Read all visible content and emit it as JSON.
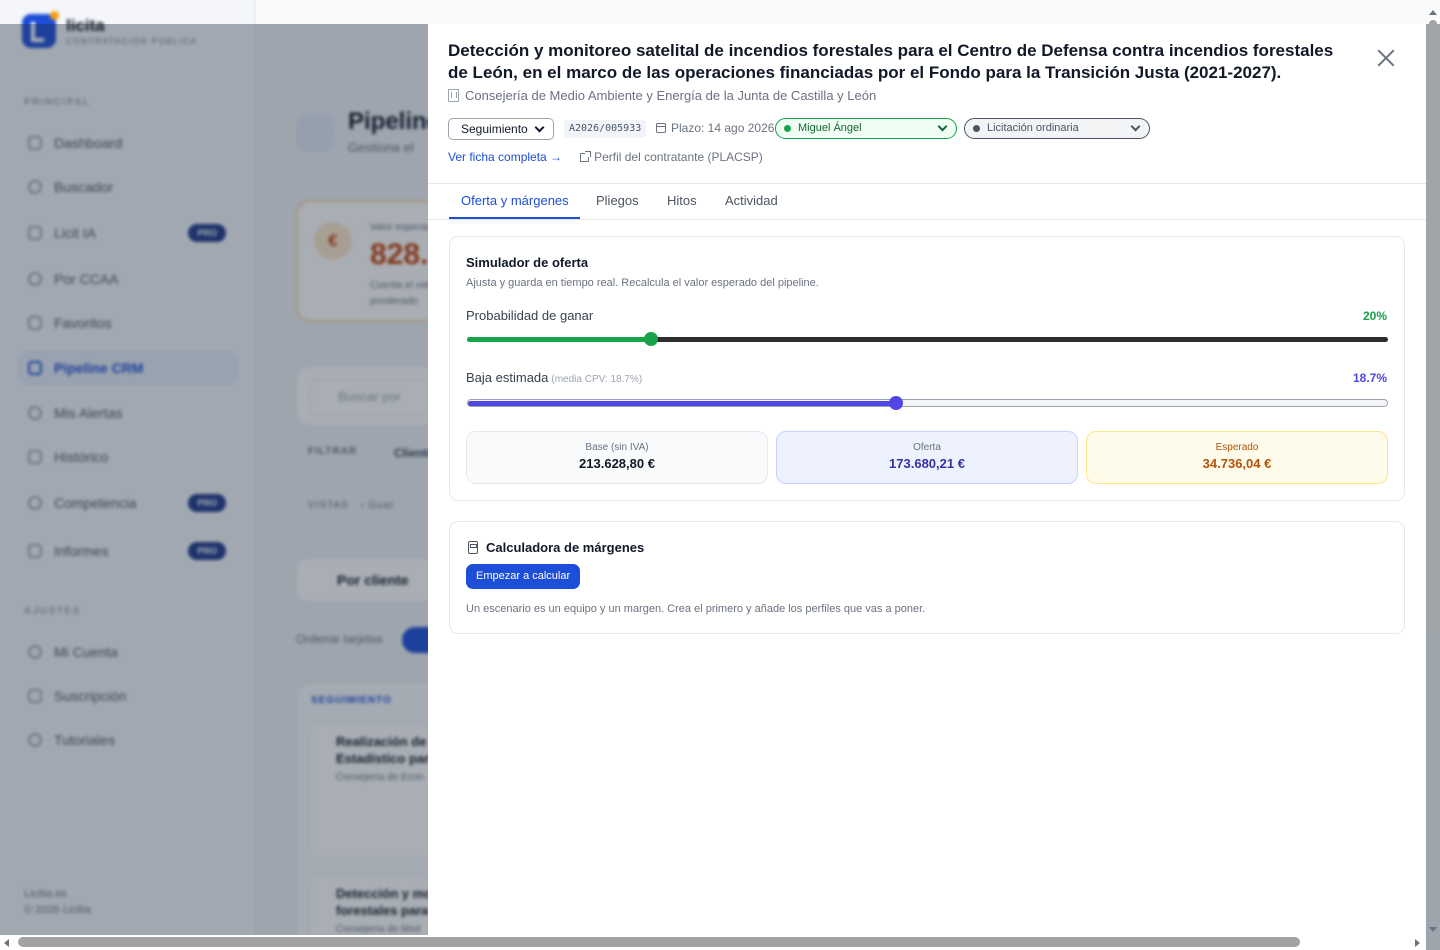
{
  "app": {
    "brand_name": "licita",
    "brand_sub": "CONTRATACIÓN PÚBLICA",
    "sections": {
      "main": "PRINCIPAL",
      "settings": "AJUSTES"
    },
    "nav": [
      {
        "label": "Dashboard",
        "icon": "grid-icon"
      },
      {
        "label": "Buscador",
        "icon": "search-icon"
      },
      {
        "label": "Licit IA",
        "icon": "sparkle-icon",
        "badge": "PRO"
      },
      {
        "label": "Por CCAA",
        "icon": "map-icon"
      },
      {
        "label": "Favoritos",
        "icon": "heart-icon"
      },
      {
        "label": "Pipeline CRM",
        "icon": "briefcase-icon",
        "active": true
      },
      {
        "label": "Mis Alertas",
        "icon": "bell-icon"
      },
      {
        "label": "Histórico",
        "icon": "history-icon"
      },
      {
        "label": "Competencia",
        "icon": "target-icon",
        "badge": "PRO"
      },
      {
        "label": "Informes",
        "icon": "chart-icon",
        "badge": "PRO"
      }
    ],
    "settings_nav": [
      {
        "label": "Mi Cuenta",
        "icon": "user-icon"
      },
      {
        "label": "Suscripción",
        "icon": "card-icon"
      },
      {
        "label": "Tutoriales",
        "icon": "help-icon"
      }
    ],
    "footer": {
      "line1": "Licitia.es",
      "line2": "© 2026 Licitia"
    },
    "page": {
      "title": "Pipeline",
      "subtitle": "Gestiona el",
      "card_label": "Valor esperado",
      "card_value": "828.",
      "card_note1": "Cuenta el valor",
      "card_note2": "ponderado",
      "search_placeholder": "Buscar por",
      "filter_label": "FILTRAR",
      "filter_value": "Cliente",
      "views_label": "VISTAS",
      "views_value": "Guar",
      "group_label": "Por cliente",
      "order_label": "Ordenar tarjetas",
      "column_label": "SEGUIMIENTO",
      "card1_title_1": "Realización de o",
      "card1_title_2": "Estadístico para",
      "card1_org": "Consejería de Econ",
      "card2_title_1": "Detección y mon",
      "card2_title_2": "forestales para e",
      "card2_org": "Consejería de Med"
    }
  },
  "drawer": {
    "title": "Detección y monitoreo satelital de incendios forestales para el Centro de Defensa contra incendios forestales de León, en el marco de las operaciones financiadas por el Fondo para la Transición Justa (2021-2027).",
    "organization": "Consejería de Medio Ambiente y Energía de la Junta de Castilla y León",
    "status": "Seguimiento",
    "reference": "A2026/005933",
    "deadline": "Plazo: 14 ago 2026",
    "assignee": "Miguel Ángel",
    "procedure": "Licitación ordinaria",
    "link_full": "Ver ficha completa →",
    "link_profile": "Perfil del contratante (PLACSP)",
    "tabs": [
      "Oferta y márgenes",
      "Pliegos",
      "Hitos",
      "Actividad"
    ],
    "active_tab": 0,
    "simulator": {
      "title": "Simulador de oferta",
      "subtitle": "Ajusta y guarda en tiempo real. Recalcula el valor esperado del pipeline.",
      "win_label": "Probabilidad de ganar",
      "win_value": "20%",
      "win_fraction": 0.2,
      "discount_label": "Baja estimada",
      "discount_hint": "(media CPV: 18.7%)",
      "discount_value": "18.7%",
      "discount_fraction": 0.466,
      "base_label": "Base (sin IVA)",
      "base_value": "213.628,80 €",
      "offer_label": "Oferta",
      "offer_value": "173.680,21 €",
      "expected_label": "Esperado",
      "expected_value": "34.736,04 €"
    },
    "calculator": {
      "title": "Calculadora de márgenes",
      "button": "Empezar a calcular",
      "note": "Un escenario es un equipo y un margen. Crea el primero y añade los perfiles que vas a poner."
    }
  },
  "colors": {
    "primary": "#1d4ed8",
    "win": "#16a34a",
    "discount": "#4f46e5",
    "expected": "#b45309"
  }
}
